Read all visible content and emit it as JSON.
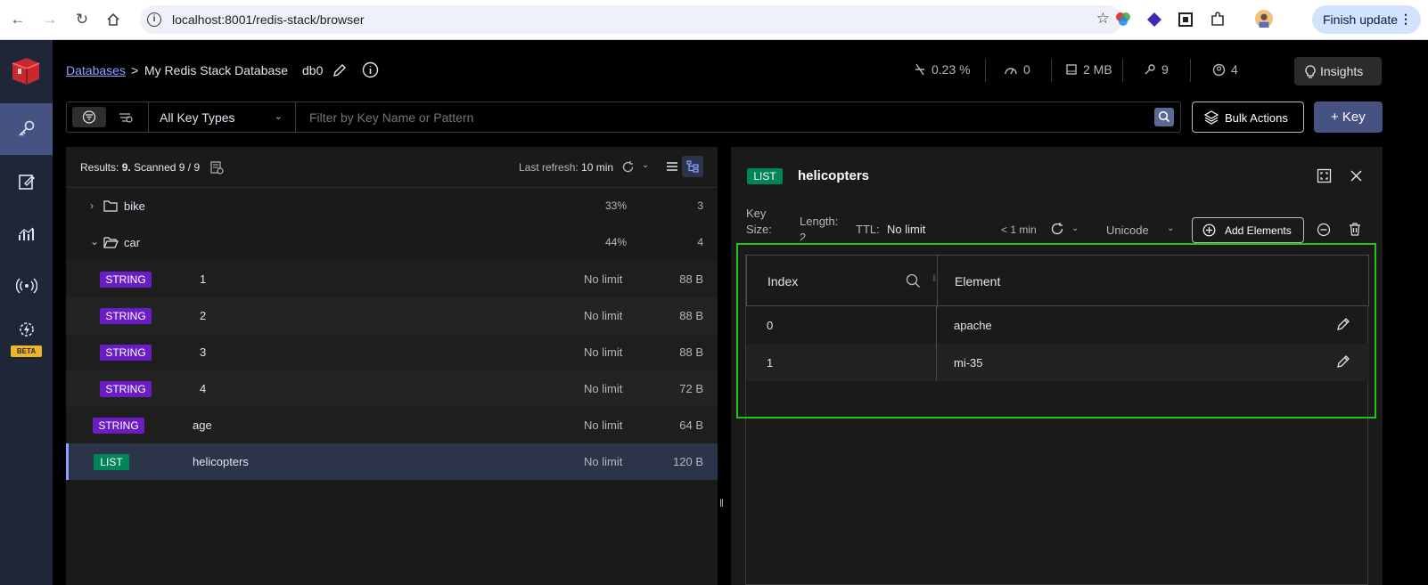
{
  "browser": {
    "url": "localhost:8001/redis-stack/browser",
    "finish_update": "Finish update"
  },
  "header": {
    "breadcrumb_databases": "Databases",
    "breadcrumb_sep": ">",
    "db_name": "My Redis Stack Database",
    "db_index": "db0",
    "cpu": "0.23 %",
    "ops": "0",
    "memory": "2 MB",
    "keys": "9",
    "clients": "4",
    "insights": "Insights"
  },
  "filter": {
    "key_types": "All Key Types",
    "placeholder": "Filter by Key Name or Pattern",
    "bulk_actions": "Bulk Actions",
    "add_key": "+ Key"
  },
  "list": {
    "results_label": "Results:",
    "results_count": "9.",
    "scanned": "Scanned 9 / 9",
    "last_refresh_label": "Last refresh:",
    "last_refresh_value": "10 min",
    "folders": [
      {
        "name": "bike",
        "pct": "33%",
        "count": "3"
      },
      {
        "name": "car",
        "pct": "44%",
        "count": "4"
      }
    ],
    "keys": [
      {
        "type": "STRING",
        "name": "1",
        "ttl": "No limit",
        "size": "88 B"
      },
      {
        "type": "STRING",
        "name": "2",
        "ttl": "No limit",
        "size": "88 B"
      },
      {
        "type": "STRING",
        "name": "3",
        "ttl": "No limit",
        "size": "88 B"
      },
      {
        "type": "STRING",
        "name": "4",
        "ttl": "No limit",
        "size": "72 B"
      },
      {
        "type": "STRING",
        "name": "age",
        "ttl": "No limit",
        "size": "64 B"
      },
      {
        "type": "LIST",
        "name": "helicopters",
        "ttl": "No limit",
        "size": "120 B"
      }
    ]
  },
  "detail": {
    "type": "LIST",
    "key_name": "helicopters",
    "key_size_label_1": "Key",
    "key_size_label_2": "Size:",
    "length_label": "Length:",
    "length_value": "2",
    "ttl_label": "TTL:",
    "ttl_value": "No limit",
    "refresh": "< 1 min",
    "format": "Unicode",
    "add_elements": "Add Elements",
    "columns": [
      "Index",
      "Element"
    ],
    "rows": [
      {
        "index": "0",
        "element": "apache"
      },
      {
        "index": "1",
        "element": "mi-35"
      }
    ]
  },
  "nav": {
    "beta": "BETA"
  }
}
